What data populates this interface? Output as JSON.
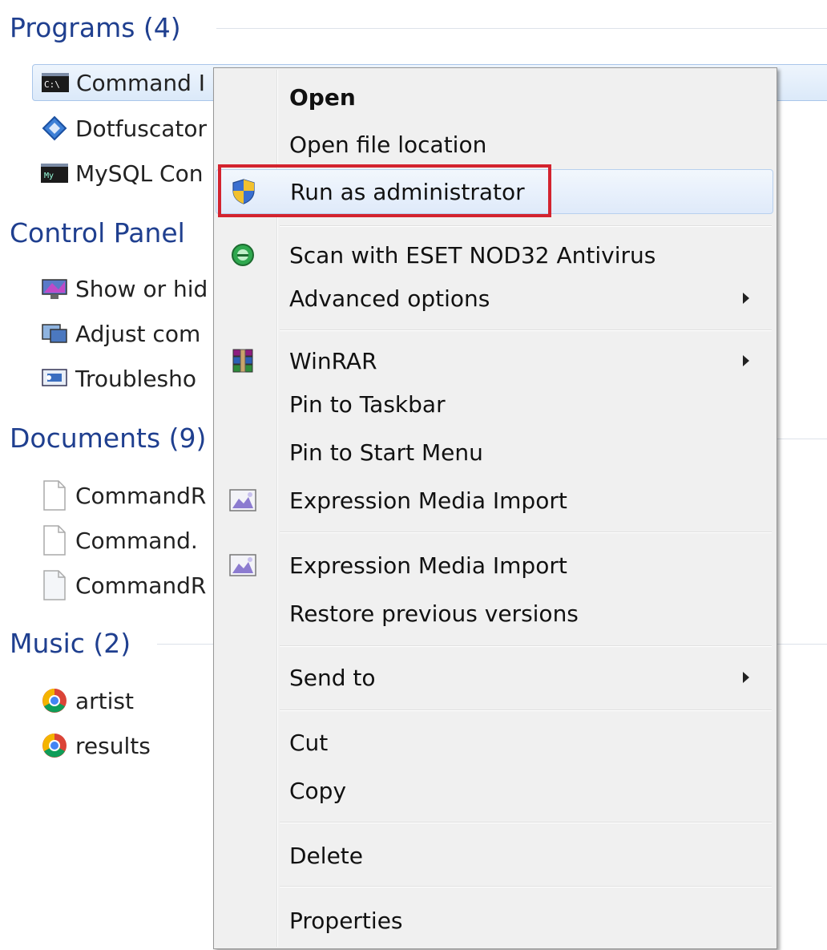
{
  "results": {
    "programs_header": "Programs (4)",
    "programs": [
      {
        "label": "Command I",
        "icon": "cmd-icon"
      },
      {
        "label": "Dotfuscator",
        "icon": "dotfuscator-icon"
      },
      {
        "label": "MySQL Con",
        "icon": "mysql-console-icon"
      }
    ],
    "control_panel_header": "Control Panel",
    "control_panel": [
      {
        "label": "Show or hid",
        "icon": "display-icon"
      },
      {
        "label": "Adjust com",
        "icon": "adjust-icon"
      },
      {
        "label": "Troublesho",
        "icon": "troubleshoot-icon"
      }
    ],
    "documents_header": "Documents (9)",
    "documents": [
      {
        "label": "CommandR",
        "icon": "document-icon"
      },
      {
        "label": "Command.",
        "icon": "document-icon"
      },
      {
        "label": "CommandR",
        "icon": "document-icon"
      }
    ],
    "music_header": "Music (2)",
    "music": [
      {
        "label": "artist",
        "icon": "chrome-icon"
      },
      {
        "label": "results",
        "icon": "chrome-icon"
      }
    ]
  },
  "context_menu": {
    "items": [
      {
        "label": "Open"
      },
      {
        "label": "Open file location"
      },
      {
        "label": "Run as administrator",
        "icon": "uac-shield-icon"
      },
      {
        "label": "Scan with ESET NOD32 Antivirus",
        "icon": "eset-icon"
      },
      {
        "label": "Advanced options"
      },
      {
        "label": "WinRAR",
        "icon": "winrar-icon"
      },
      {
        "label": "Pin to Taskbar"
      },
      {
        "label": "Pin to Start Menu"
      },
      {
        "label": "Expression Media Import",
        "icon": "expression-media-icon"
      },
      {
        "label": "Expression Media Import",
        "icon": "expression-media-icon"
      },
      {
        "label": "Restore previous versions"
      },
      {
        "label": "Send to"
      },
      {
        "label": "Cut"
      },
      {
        "label": "Copy"
      },
      {
        "label": "Delete"
      },
      {
        "label": "Properties"
      }
    ]
  },
  "colors": {
    "highlight_border": "#d3232f",
    "group_header": "#1f3f8f"
  }
}
